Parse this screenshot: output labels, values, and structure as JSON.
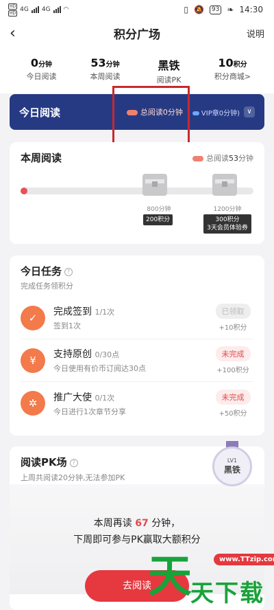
{
  "status_bar": {
    "sim1": "HD",
    "sim2": "HD",
    "network": "4G",
    "battery": "93",
    "time": "14:30"
  },
  "nav": {
    "back_icon": "chevron-left-icon",
    "title": "积分广场",
    "help_label": "说明"
  },
  "stats": [
    {
      "value": "0",
      "unit": "分钟",
      "label": "今日阅读"
    },
    {
      "value": "53",
      "unit": "分钟",
      "label": "本周阅读"
    },
    {
      "value": "黑铁",
      "unit": "",
      "label": "阅读PK"
    },
    {
      "value": "10",
      "unit": "积分",
      "label": "积分商城>"
    }
  ],
  "today_banner": {
    "title": "今日阅读",
    "total_label": "总阅读0分钟",
    "vip_label": "VIP章0分钟)",
    "chevron_icon": "chevron-down-icon"
  },
  "week": {
    "title": "本周阅读",
    "total_prefix": "总阅读",
    "total_value": "53",
    "total_unit": "分钟",
    "progress_fraction": 0.03,
    "milestones": [
      {
        "minutes_label": "800分钟",
        "reward": "200积分",
        "reward2": ""
      },
      {
        "minutes_label": "1200分钟",
        "reward": "300积分",
        "reward2": "3天会员体验券"
      }
    ]
  },
  "tasks": {
    "title": "今日任务",
    "subtitle": "完成任务领积分",
    "items": [
      {
        "icon": "calendar-check-icon",
        "name": "完成签到",
        "count": "1/1次",
        "desc": "签到1次",
        "state": "已领取",
        "reward": "+10积分",
        "done": true
      },
      {
        "icon": "yen-coin-icon",
        "name": "支持原创",
        "count": "0/30点",
        "desc": "今日使用有价币订阅达30点",
        "state": "未完成",
        "reward": "+100积分",
        "done": false
      },
      {
        "icon": "share-icon",
        "name": "推广大使",
        "count": "0/1次",
        "desc": "今日进行1次章节分享",
        "state": "未完成",
        "reward": "+50积分",
        "done": false
      }
    ]
  },
  "pk": {
    "title": "阅读PK场",
    "subtitle": "上周共阅读20分钟,无法参加PK",
    "medal_level": "LV1",
    "medal_name": "黑铁",
    "msg_prefix": "本周再读",
    "msg_value": "67",
    "msg_suffix": "分钟，",
    "msg_line2": "下周即可参与PK赢取大额积分",
    "button": "去阅读"
  },
  "watermark": {
    "url": "www.TTzip.com",
    "big": "天",
    "text": "天下载"
  },
  "colors": {
    "banner": "#263a84",
    "accent_red": "#e5383f",
    "task_icon": "#f37a4a"
  }
}
